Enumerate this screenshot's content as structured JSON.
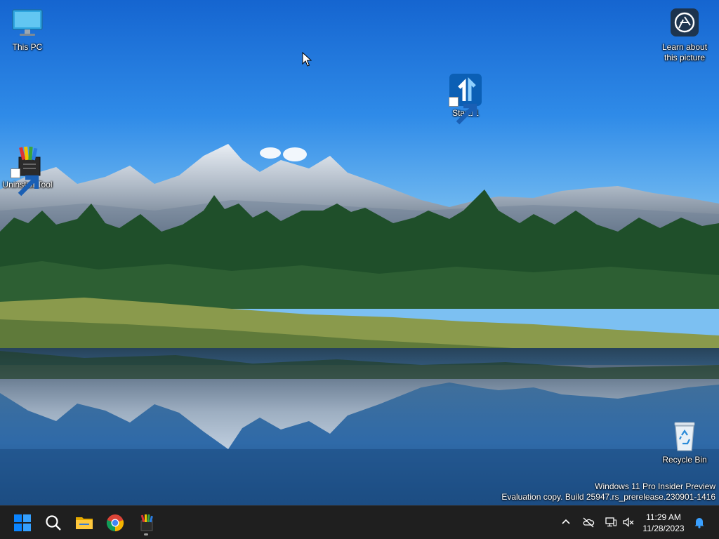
{
  "desktop": {
    "icons": [
      {
        "label": "This PC",
        "icon": "monitor-icon"
      },
      {
        "label": "Start11",
        "icon": "start11-icon"
      },
      {
        "label": "Uninstall Tool",
        "icon": "uninstall-tool-icon"
      },
      {
        "label": "Learn about\nthis picture",
        "icon": "camera-info-icon"
      },
      {
        "label": "Recycle Bin",
        "icon": "recycle-bin-icon"
      }
    ],
    "watermark": {
      "line1": "Windows 11 Pro Insider Preview",
      "line2": "Evaluation copy. Build 25947.rs_prerelease.230901-1416"
    }
  },
  "taskbar": {
    "apps": [
      {
        "name": "Start",
        "icon": "windows-logo-icon"
      },
      {
        "name": "Search",
        "icon": "search-icon"
      },
      {
        "name": "File Explorer",
        "icon": "folder-icon"
      },
      {
        "name": "Google Chrome",
        "icon": "chrome-icon"
      },
      {
        "name": "Uninstall Tool",
        "icon": "uninstall-tool-icon"
      }
    ],
    "tray": {
      "icons": [
        "chevron-up-icon",
        "onedrive-offline-icon",
        "network-icon",
        "volume-muted-icon",
        "notification-bell-icon"
      ],
      "time": "11:29 AM",
      "date": "11/28/2023"
    }
  },
  "colors": {
    "taskbar": "#1f1f1f",
    "windows_blue": "#0a84ff",
    "start11_blue": "#0b5fb5"
  }
}
